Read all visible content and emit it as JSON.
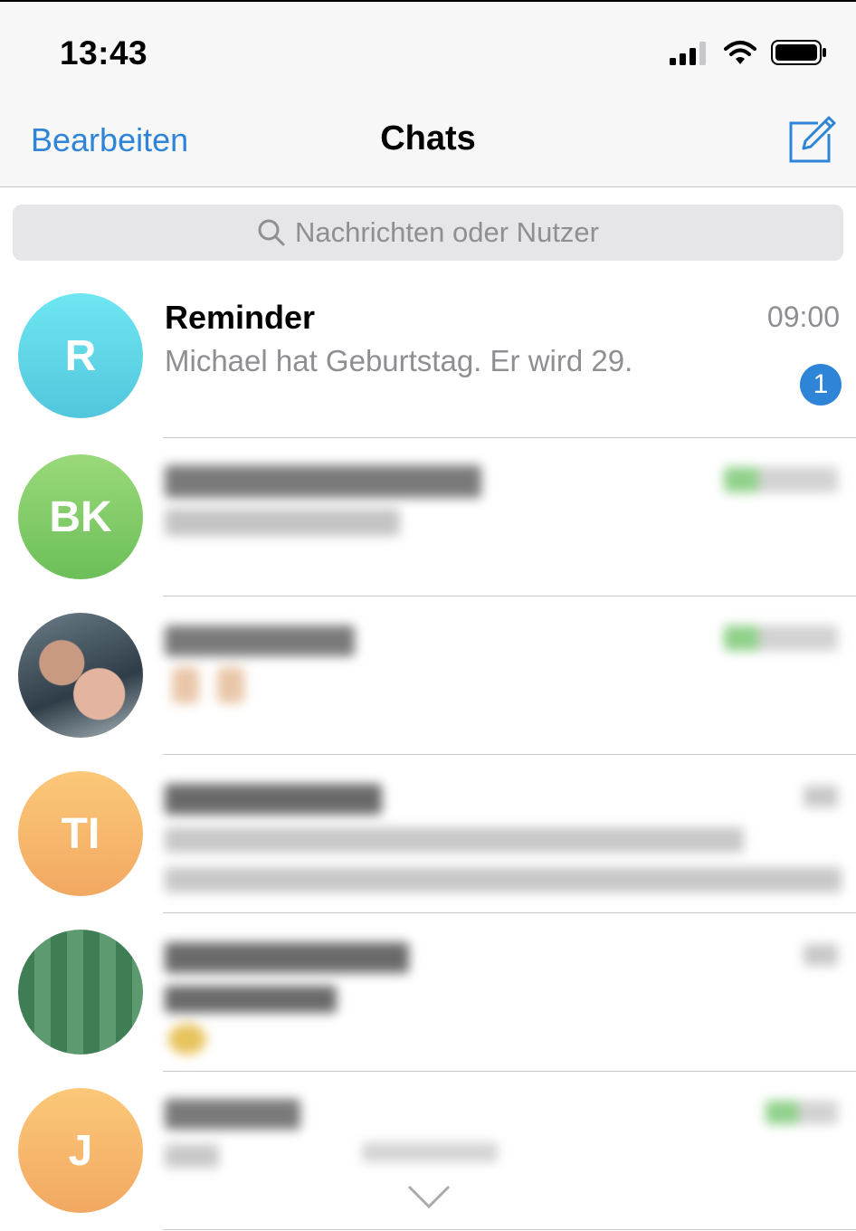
{
  "status_bar": {
    "time": "13:43",
    "icons": [
      "cellular-signal-icon",
      "wifi-icon",
      "battery-icon"
    ]
  },
  "nav": {
    "edit_label": "Bearbeiten",
    "title": "Chats",
    "compose_icon": "compose-icon"
  },
  "search": {
    "placeholder": "Nachrichten oder Nutzer",
    "icon": "search-icon"
  },
  "colors": {
    "accent": "#2e84d6",
    "secondary_text": "#8e8e93"
  },
  "chats": [
    {
      "initials": "R",
      "name": "Reminder",
      "time": "09:00",
      "preview": "Michael hat Geburtstag. Er wird 29.",
      "unread": "1",
      "avatar_colors": [
        "#6ee6f2",
        "#52c6dc"
      ]
    },
    {
      "initials": "BK",
      "avatar_colors": [
        "#9ad97a",
        "#6cbf59"
      ]
    },
    {
      "initials": "",
      "avatar_kind": "photo"
    },
    {
      "initials": "TI",
      "avatar_colors": [
        "#fbc878",
        "#f2a862"
      ]
    },
    {
      "initials": "",
      "avatar_kind": "photo"
    },
    {
      "initials": "J",
      "avatar_colors": [
        "#fbc878",
        "#f2a862"
      ]
    }
  ]
}
